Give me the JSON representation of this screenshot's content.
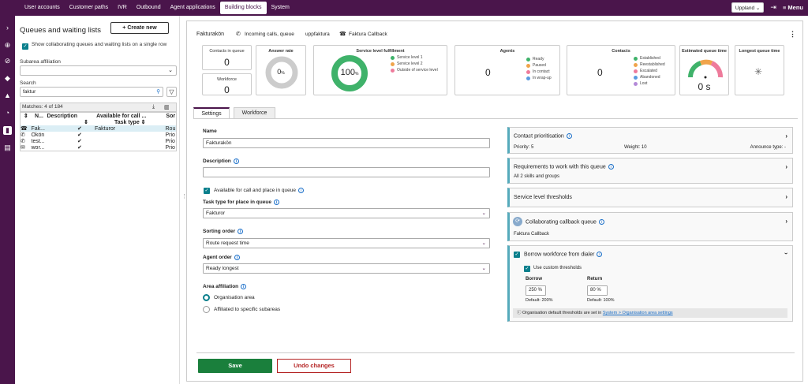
{
  "nav": {
    "tabs": [
      "User accounts",
      "Customer paths",
      "IVR",
      "Outbound",
      "Agent applications",
      "Building blocks",
      "System"
    ],
    "active": "Building blocks",
    "unit": "Uppland",
    "menu": "Menu"
  },
  "left": {
    "title": "Queues and waiting lists",
    "create": "Create new",
    "show_collab": "Show collaborating queues and waiting lists on a single row",
    "subarea_label": "Subarea affiliation",
    "search_label": "Search",
    "search_value": "faktur",
    "matches": "Matches: 4 of 184",
    "headers": {
      "name": "N...",
      "description": "Description",
      "available": "Available for call ...",
      "task_type": "Task type",
      "sort": "Sor"
    },
    "rows": [
      {
        "name": "Fak...",
        "check": "✔",
        "task": "Fakturor",
        "sort": "Rou"
      },
      {
        "name": "Okön",
        "check": "✔",
        "task": "",
        "sort": "Prio"
      },
      {
        "name": "test...",
        "check": "✔",
        "task": "",
        "sort": "Prio"
      },
      {
        "name": "wor...",
        "check": "✔",
        "task": "",
        "sort": "Prio"
      }
    ]
  },
  "header": {
    "queue": "Fakturakön",
    "incoming": "Incoming calls, queue",
    "ext": "uppfaktura",
    "callback": "Faktura Callback"
  },
  "stats": {
    "contacts_in_queue": {
      "label": "Contacts in queue",
      "value": "0"
    },
    "workforce": {
      "label": "Workforce",
      "value": "0"
    },
    "answer_rate": {
      "label": "Answer rate",
      "value": "0",
      "unit": "%"
    },
    "slf": {
      "label": "Service level fulfillment",
      "value": "100",
      "unit": "%",
      "legend": [
        "Service level 1",
        "Service level 2",
        "Outside of service level"
      ]
    },
    "agents": {
      "label": "Agents",
      "value": "0",
      "legend": [
        "Ready",
        "Paused",
        "In contact",
        "In wrap-up"
      ]
    },
    "contacts": {
      "label": "Contacts",
      "value": "0",
      "legend": [
        "Established",
        "Reestablished",
        "Escalated",
        "Abandoned",
        "Lost"
      ]
    },
    "eqt": {
      "label": "Estimated queue time",
      "value": "0 s"
    },
    "lqt": {
      "label": "Longest queue time"
    }
  },
  "subtabs": {
    "settings": "Settings",
    "workforce": "Workforce"
  },
  "form": {
    "name_label": "Name",
    "name_value": "Fakturakön",
    "desc_label": "Description",
    "available": "Available for call and place in queue",
    "task_label": "Task type for place in queue",
    "task_value": "Fakturor",
    "sort_label": "Sorting order",
    "sort_value": "Route request time",
    "agent_label": "Agent order",
    "agent_value": "Ready longest",
    "area_label": "Area affiliation",
    "area_org": "Organisation area",
    "area_sub": "Affiliated to specific subareas"
  },
  "right": {
    "prio_title": "Contact prioritisation",
    "prio": "Priority: 5",
    "weight": "Weight: 10",
    "announce": "Announce type: -",
    "req_title": "Requirements to work with this queue",
    "req_sub": "All 2 skills and groups",
    "slt": "Service level thresholds",
    "ccq_title": "Collaborating callback queue",
    "ccq_sub": "Faktura Callback",
    "borrow_title": "Borrow workforce from dialer",
    "custom": "Use custom thresholds",
    "borrow": "Borrow",
    "borrow_val": "250",
    "borrow_def": "Default: 200%",
    "return": "Return",
    "return_val": "80",
    "return_def": "Default: 100%",
    "note": "Organisation default thresholds are set in",
    "note_link": "System > Organisation area settings"
  },
  "actions": {
    "save": "Save",
    "undo": "Undo changes"
  }
}
